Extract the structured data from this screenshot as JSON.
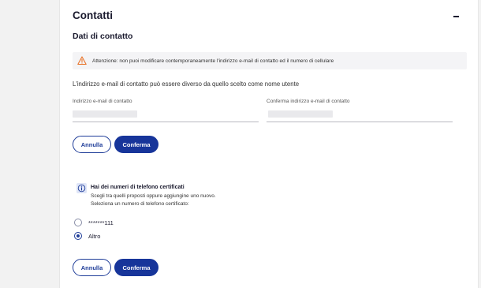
{
  "section": {
    "title": "Contatti",
    "subtitle": "Dati di contatto"
  },
  "warning": {
    "text": "Attenzione: non puoi modificare contemporaneamente l'indirizzo e-mail di contatto ed il numero di cellulare",
    "icon": "warning-triangle-icon",
    "icon_color": "#e8742a"
  },
  "info_line": "L'indirizzo e-mail di contatto può essere diverso da quello scelto come nome utente",
  "email_form": {
    "email_label": "Indirizzo e-mail di contatto",
    "confirm_label": "Conferma indirizzo e-mail di contatto",
    "cancel_label": "Annulla",
    "confirm_button_label": "Conferma"
  },
  "certified": {
    "title": "Hai dei numeri di telefono certificati",
    "desc_line1": "Scegli tra quelli proposti oppure aggiungine uno nuovo.",
    "desc_line2": "Seleziona un numero di telefono certificato:",
    "icon": "info-icon",
    "options": [
      {
        "label": "*******111",
        "selected": false
      },
      {
        "label": "Altro",
        "selected": true
      }
    ],
    "cancel_label": "Annulla",
    "confirm_button_label": "Conferma"
  },
  "colors": {
    "primary": "#17359a",
    "accent_warning": "#e8742a",
    "page_bg": "#f2f2f2"
  }
}
